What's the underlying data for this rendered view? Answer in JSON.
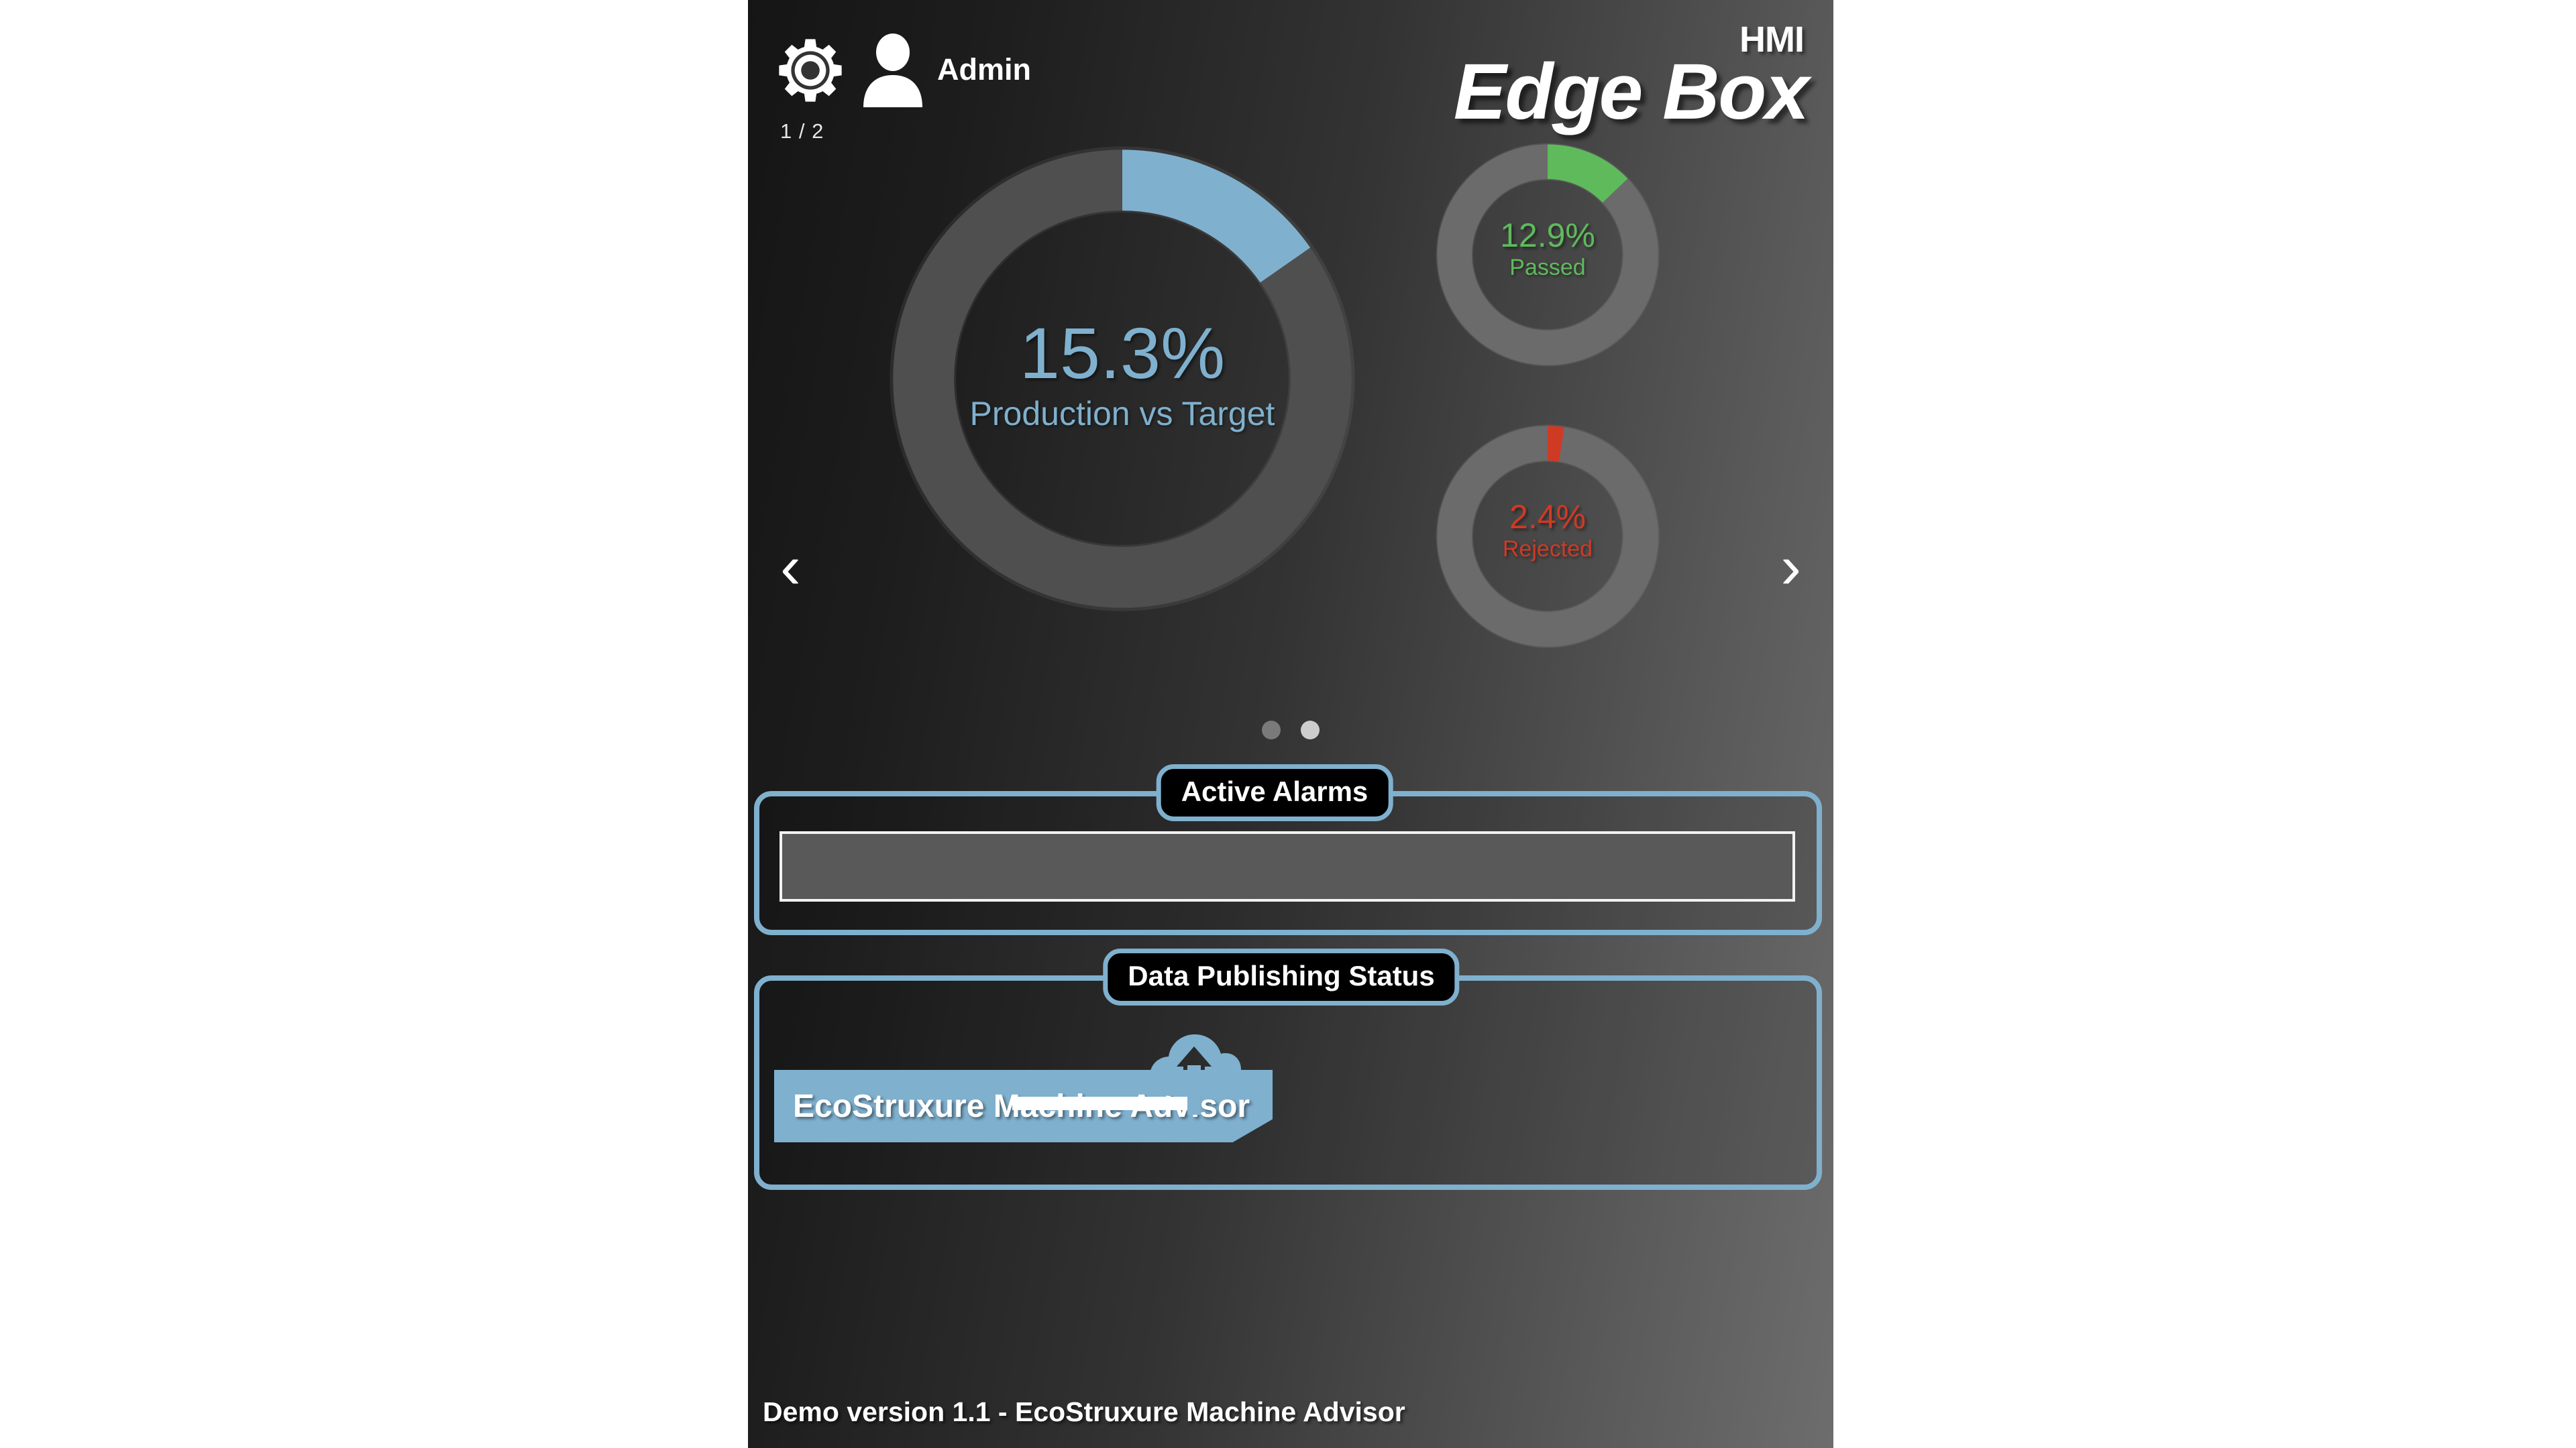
{
  "app": {
    "brand_sub": "HMI",
    "brand_main": "Edge Box",
    "user_name": "Admin",
    "page_counter": "1 / 2",
    "gear_icon": "gear-icon",
    "user_icon": "user-icon",
    "footer": "Demo version 1.1 - EcoStruxure Machine Advisor"
  },
  "carousel": {
    "prev_label": "‹",
    "next_label": "›",
    "dots": [
      {
        "state": "inactive"
      },
      {
        "state": "active"
      }
    ]
  },
  "chart_data": [
    {
      "type": "pie",
      "title": "Production vs Target",
      "variant": "donut-gauge",
      "value": 15.3,
      "value_label": "15.3%",
      "caption": "Production vs Target",
      "max": 100,
      "unit": "%",
      "start_angle_deg": 0,
      "color": "#7FB0CE",
      "track_color": "#4f4f4f"
    },
    {
      "type": "pie",
      "title": "Passed",
      "variant": "donut-gauge",
      "value": 12.9,
      "value_label": "12.9%",
      "caption": "Passed",
      "max": 100,
      "unit": "%",
      "start_angle_deg": 0,
      "color": "#5FBA5C",
      "track_color": "#6b6b6b"
    },
    {
      "type": "pie",
      "title": "Rejected",
      "variant": "donut-gauge",
      "value": 2.4,
      "value_label": "2.4%",
      "caption": "Rejected",
      "max": 100,
      "unit": "%",
      "start_angle_deg": 0,
      "color": "#CF3A25",
      "track_color": "#6b6b6b"
    }
  ],
  "alarms": {
    "title": "Active Alarms",
    "items": []
  },
  "publishing": {
    "title": "Data Publishing Status",
    "service_label": "EcoStruxure Machine Advisor",
    "cloud_icon": "cloud-upload-icon"
  },
  "colors": {
    "accent_blue": "#7FB0CE",
    "passed_green": "#5FBA5C",
    "rejected_red": "#CF3A25",
    "panel_black": "#000000"
  }
}
